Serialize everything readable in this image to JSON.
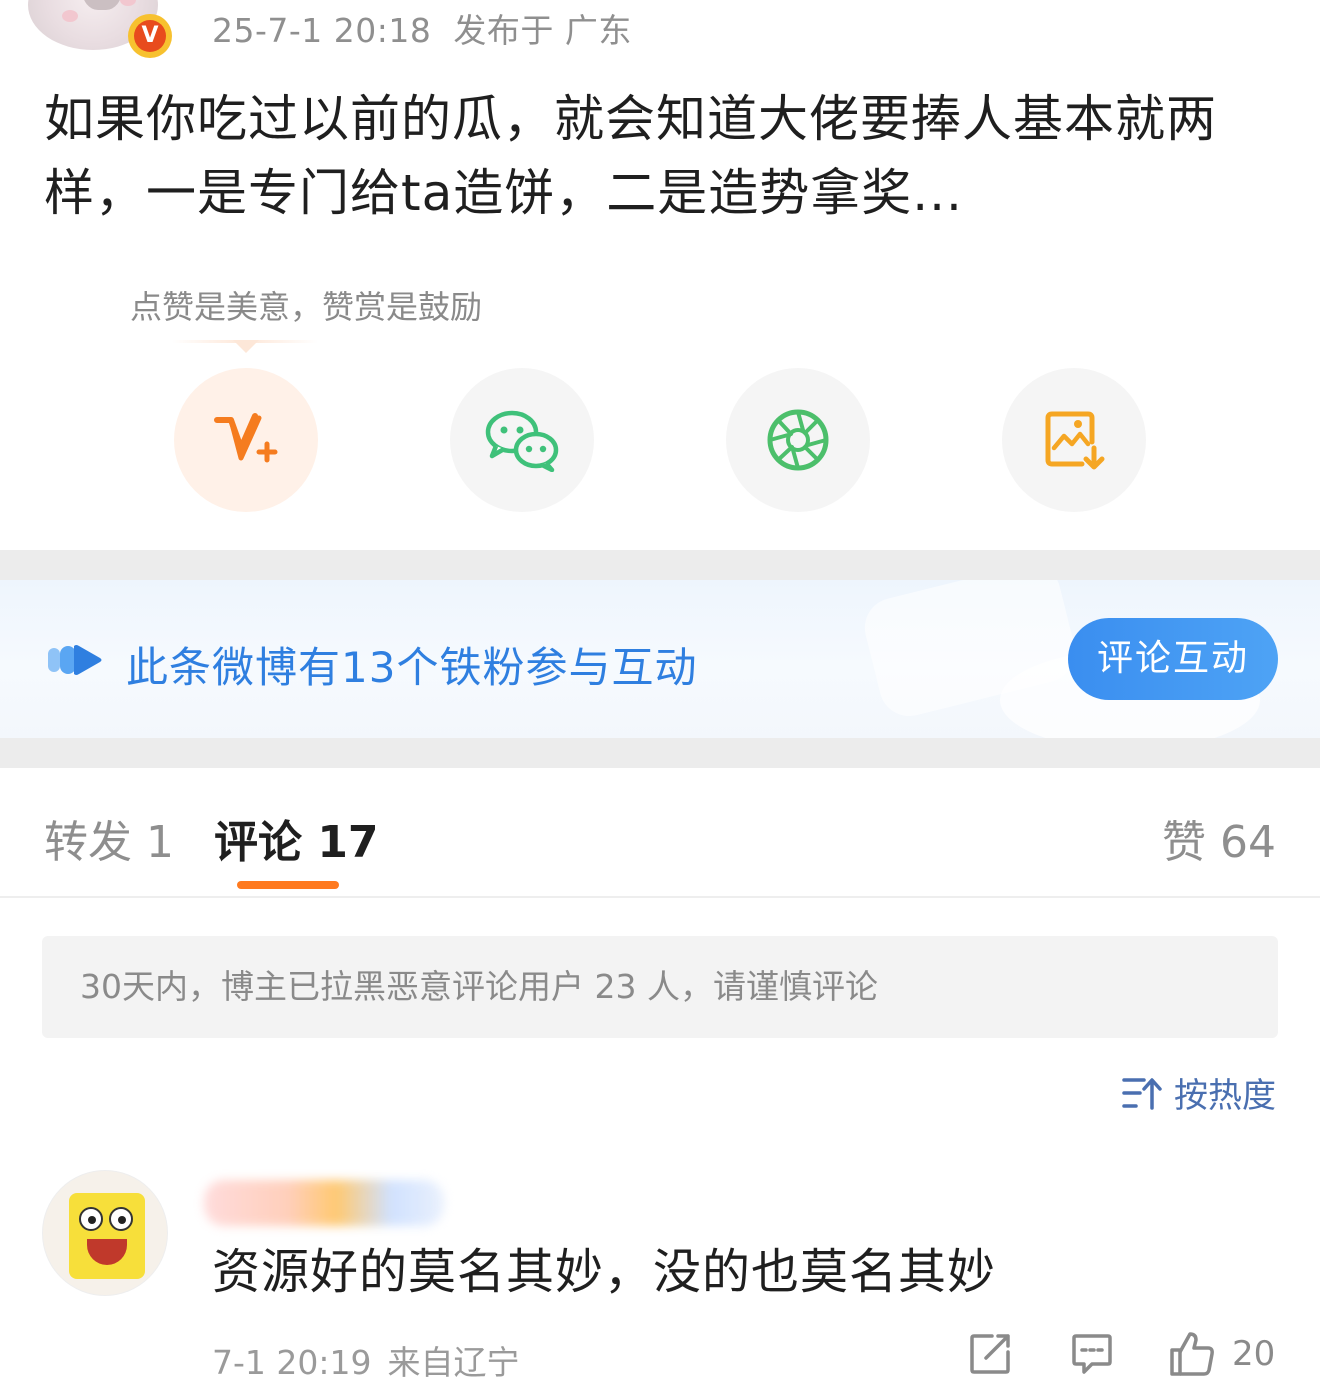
{
  "post": {
    "time": "25-7-1 20:18",
    "location": "发布于 广东",
    "vip_badge": "V",
    "text": "如果你吃过以前的瓜，就会知道大佬要捧人基本就两样，一是专门给ta造饼，二是造势拿奖..."
  },
  "reward": {
    "tip": "点赞是美意，赞赏是鼓励"
  },
  "share": {
    "items": [
      {
        "icon": "reward-v-plus-icon"
      },
      {
        "icon": "wechat-icon"
      },
      {
        "icon": "moments-icon"
      },
      {
        "icon": "save-image-icon"
      }
    ]
  },
  "fans_banner": {
    "text": "此条微博有13个铁粉参与互动",
    "button": "评论互动"
  },
  "tabs": {
    "forward": "转发 1",
    "comment": "评论 17",
    "like": "赞 64"
  },
  "notice": "30天内，博主已拉黑恶意评论用户 23 人，请谨慎评论",
  "sort": {
    "label": "按热度"
  },
  "comments": [
    {
      "text": "资源好的莫名其妙，没的也莫名其妙",
      "time": "7-1 20:19",
      "source": "来自辽宁",
      "likes": "20"
    }
  ],
  "colors": {
    "accent_orange": "#ff7a1f",
    "link_blue": "#2f7fe0",
    "wechat_green": "#3fc17a"
  }
}
